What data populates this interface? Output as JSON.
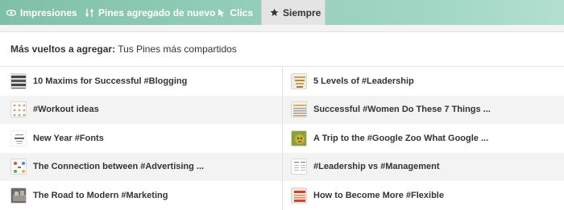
{
  "tabs": [
    {
      "label": "Impresiones",
      "icon": "eye-icon"
    },
    {
      "label": "Pines agregado de nuevo",
      "icon": "repin-icon"
    },
    {
      "label": "Clics",
      "icon": "cursor-icon"
    },
    {
      "label": "Siempre",
      "icon": "star-icon",
      "active": true
    }
  ],
  "header": {
    "bold": "Más vueltos a agregar:",
    "rest": "Tus Pines más compartidos"
  },
  "pins_left": [
    {
      "title": "10 Maxims for Successful #Blogging",
      "icon": "stripes-thumbnail-icon"
    },
    {
      "title": "#Workout ideas",
      "icon": "workout-grid-thumbnail-icon"
    },
    {
      "title": "New Year #Fonts",
      "icon": "fonts-thumbnail-icon"
    },
    {
      "title": "The Connection between #Advertising ...",
      "icon": "advertising-thumbnail-icon"
    },
    {
      "title": "The Road to Modern #Marketing",
      "icon": "marketing-thumbnail-icon"
    }
  ],
  "pins_right": [
    {
      "title": "5 Levels of #Leadership",
      "icon": "leadership-thumbnail-icon"
    },
    {
      "title": "Successful #Women Do These 7 Things ...",
      "icon": "women-thumbnail-icon"
    },
    {
      "title": "A Trip to the #Google Zoo What Google ...",
      "icon": "google-zoo-thumbnail-icon"
    },
    {
      "title": "#Leadership vs #Management",
      "icon": "management-thumbnail-icon"
    },
    {
      "title": "How to Become More #Flexible",
      "icon": "flexible-thumbnail-icon"
    }
  ],
  "colors": {
    "topbar_start": "#7fc0a8",
    "topbar_end": "#b2dfd0",
    "active_tab_bg": "#e4e4e4",
    "text": "#333333"
  }
}
